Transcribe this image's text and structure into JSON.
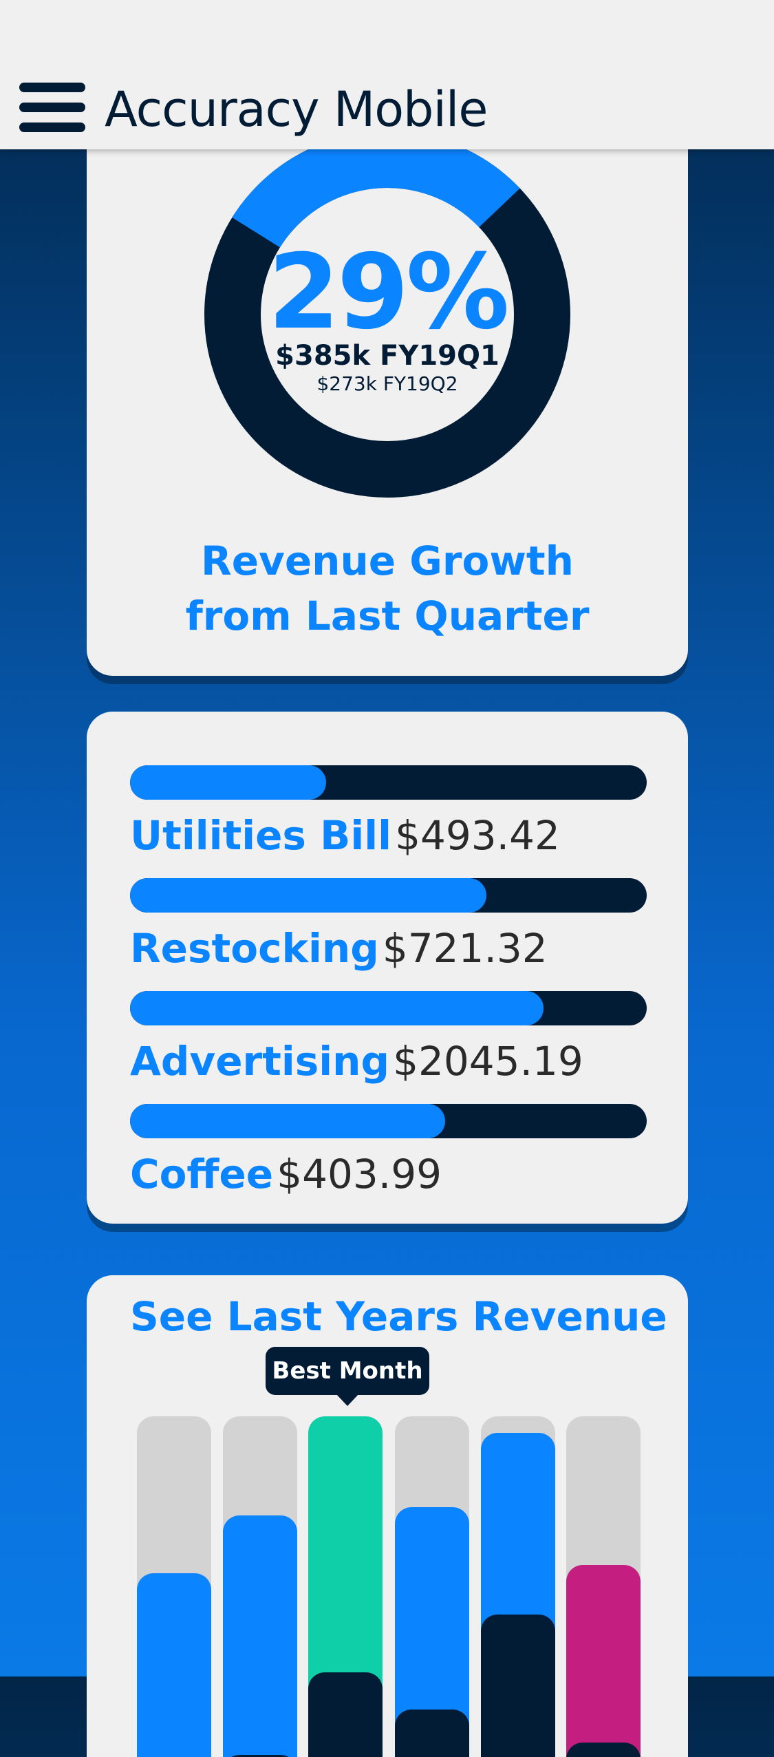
{
  "header": {
    "title": "Accuracy Mobile",
    "menu_icon": "hamburger-menu-icon"
  },
  "growth": {
    "value": "29%",
    "fraction": 0.29,
    "current": "$385k FY19Q1",
    "previous": "$273k FY19Q2",
    "caption_line1": "Revenue Growth",
    "caption_line2": "from Last Quarter"
  },
  "expenses": [
    {
      "name": "Utilities Bill",
      "amount": "$493.42",
      "fill": 0.38
    },
    {
      "name": "Restocking",
      "amount": "$721.32",
      "fill": 0.69
    },
    {
      "name": "Advertising",
      "amount": "$2045.19",
      "fill": 0.8
    },
    {
      "name": "Coffee",
      "amount": "$403.99",
      "fill": 0.61
    }
  ],
  "revenue": {
    "title": "See Last Years Revenue",
    "tooltip": "Best Month",
    "highlight_index": 2,
    "columns": [
      {
        "top_level": 0.62,
        "bottom_level": 0.1,
        "top_color": "#0a84ff"
      },
      {
        "top_level": 0.76,
        "bottom_level": 0.18,
        "top_color": "#0a84ff"
      },
      {
        "top_level": 1.0,
        "bottom_level": 0.38,
        "top_color": "#0fcfa9"
      },
      {
        "top_level": 0.78,
        "bottom_level": 0.29,
        "top_color": "#0a84ff"
      },
      {
        "top_level": 0.96,
        "bottom_level": 0.52,
        "top_color": "#0a84ff"
      },
      {
        "top_level": 0.64,
        "bottom_level": 0.21,
        "top_color": "#c41e80"
      }
    ]
  },
  "colors": {
    "accent": "#0a84ff",
    "navy": "#031c35",
    "highlight": "#0fcfa9",
    "magenta": "#c41e80",
    "card": "#f0f0f0"
  }
}
